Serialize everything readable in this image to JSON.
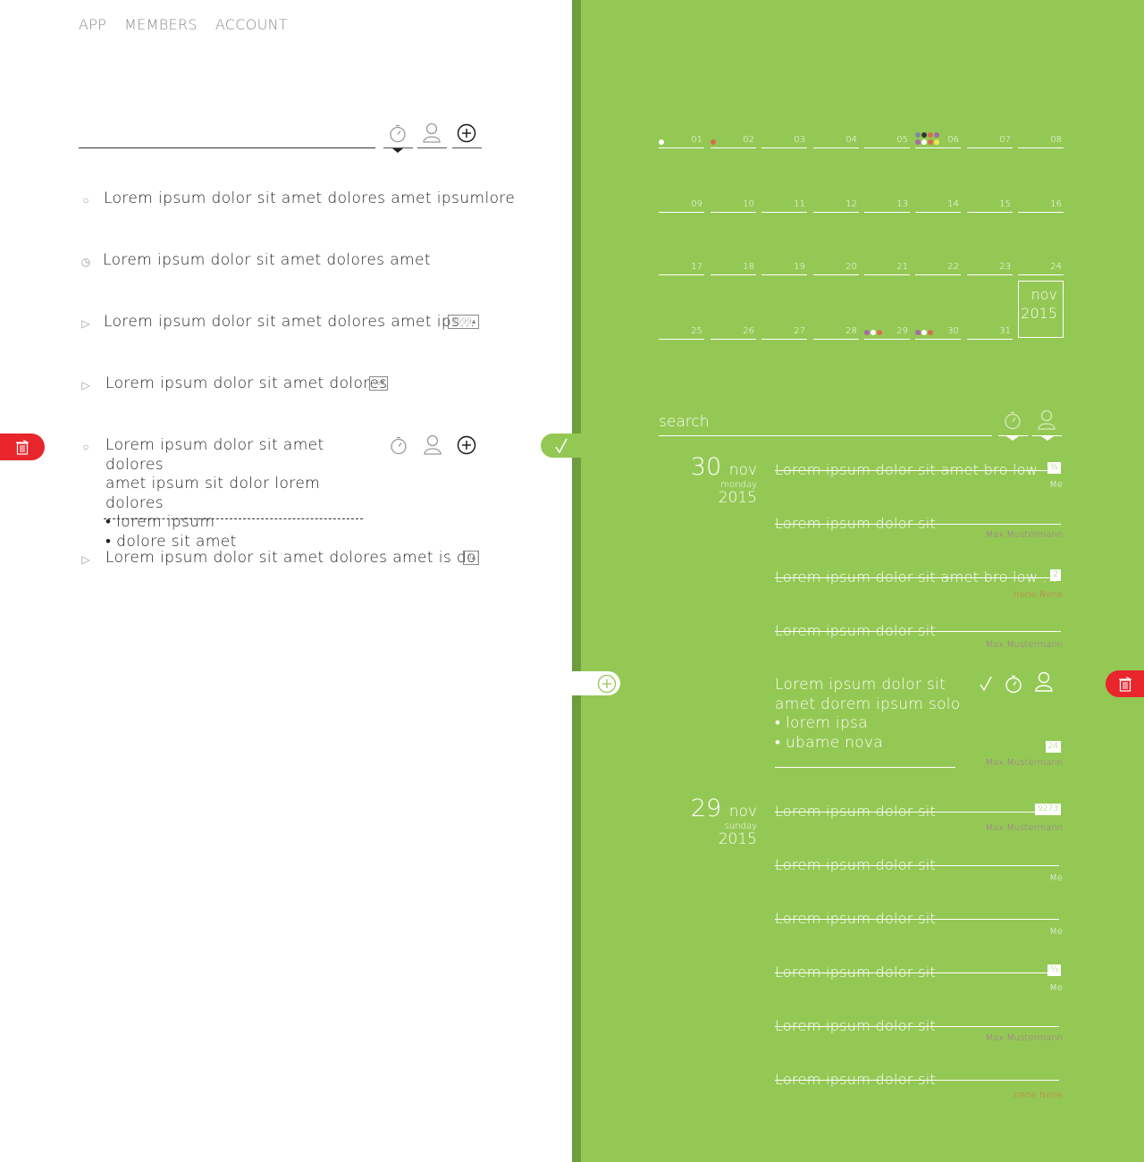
{
  "nav": {
    "items": [
      "APP",
      "MEMBERS",
      "ACCOUNT"
    ]
  },
  "tasks": [
    {
      "bullet": "○",
      "text": "Lorem ipsum dolor sit amet dolores amet ipsumlore"
    },
    {
      "bullet": "◷",
      "text": "Lorem ipsum dolor sit amet dolores amet"
    },
    {
      "bullet": "▷",
      "text": "Lorem ipsum dolor sit amet dolores amet ips...",
      "badge": "3699▴"
    },
    {
      "bullet": "▷",
      "text": "Lorem ipsum dolor sit amet dolores",
      "badge": "½▾"
    },
    {
      "bullet": "○",
      "lines": [
        "Lorem ipsum dolor sit amet dolores",
        "amet ipsum sit dolor lorem dolores",
        "• lorem ipsum",
        "• dolore sit amet"
      ]
    },
    {
      "bullet": "▷",
      "text": "Lorem ipsum dolor sit amet dolores  amet is dol",
      "badge": "0▴"
    }
  ],
  "calendar": {
    "month": "nov",
    "year": "2015",
    "days": [
      "01",
      "02",
      "03",
      "04",
      "05",
      "06",
      "07",
      "08",
      "09",
      "10",
      "11",
      "12",
      "13",
      "14",
      "15",
      "16",
      "17",
      "18",
      "19",
      "20",
      "21",
      "22",
      "23",
      "24",
      "25",
      "26",
      "27",
      "28",
      "29",
      "30",
      "31"
    ]
  },
  "search": {
    "placeholder": "search"
  },
  "done_groups": [
    {
      "day": "30",
      "month": "nov 2015",
      "weekday": "monday",
      "items": [
        {
          "text": "Lorem ipsum dolor sit amet bro low",
          "tag": "½",
          "who": "Me"
        },
        {
          "text": "Lorem ipsum dolor sit",
          "who": "Max Mustermann"
        },
        {
          "text": "Lorem ipsum dolor sit amet bro low ...",
          "tag": "2",
          "who": "Irene Nene"
        },
        {
          "text": "Lorem ipsum dolor sit",
          "who": "Max Mustermann"
        }
      ],
      "open_item": {
        "lines": [
          "Lorem ipsum dolor sit",
          "amet dorem ipsum solo",
          "• lorem ipsa",
          "• ubame nova"
        ],
        "tag": "24",
        "who": "Max Mustermann"
      }
    },
    {
      "day": "29",
      "month": "nov 2015",
      "weekday": "sunday",
      "items": [
        {
          "text": "Lorem ipsum dolor sit",
          "tag": "9273",
          "who": "Max Mustermann"
        },
        {
          "text": "Lorem ipsum dolor sit",
          "who": "Me"
        },
        {
          "text": "Lorem ipsum dolor sit",
          "who": "Me"
        },
        {
          "text": "Lorem ipsum dolor sit",
          "tag": "⅔",
          "who": "Me"
        },
        {
          "text": "Lorem ipsum dolor sit",
          "who": "Max Mustermann"
        },
        {
          "text": "Lorem ipsum dolor sit",
          "who": "Irene Nene"
        }
      ]
    }
  ],
  "colors": {
    "accent_green": "#94c854",
    "stripe_green": "#6f9d3e",
    "delete_red": "#e8262c",
    "member_purple": "#a86aa6",
    "member_orange": "#d76d50"
  },
  "icons": [
    "stopwatch-icon",
    "person-icon",
    "plus-circle-icon",
    "trash-icon",
    "check-icon",
    "chevron-down-icon"
  ]
}
